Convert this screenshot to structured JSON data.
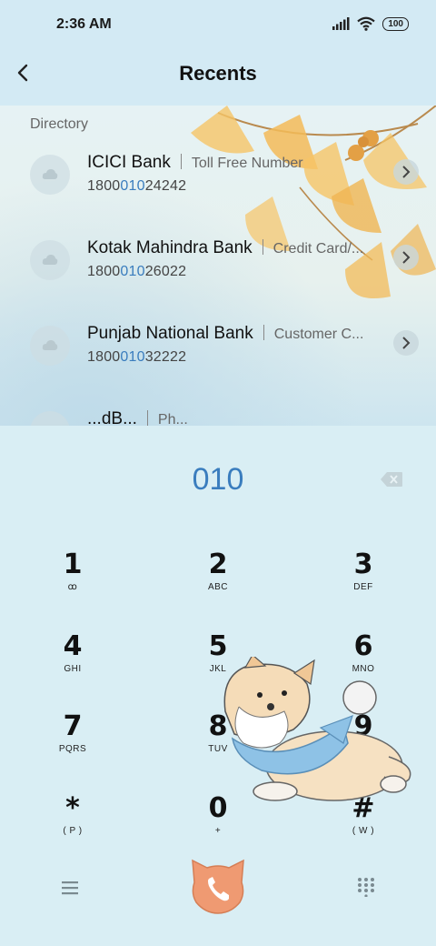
{
  "status": {
    "time": "2:36 AM",
    "battery": "100"
  },
  "header": {
    "title": "Recents"
  },
  "directory": {
    "label": "Directory",
    "items": [
      {
        "name": "ICICI Bank",
        "desc": "Toll Free Number",
        "num_pre": "1800",
        "num_hl": "010",
        "num_post": "24242"
      },
      {
        "name": "Kotak Mahindra Bank",
        "desc": "Credit Card/...",
        "num_pre": "1800",
        "num_hl": "010",
        "num_post": "26022"
      },
      {
        "name": "Punjab National Bank",
        "desc": "Customer C...",
        "num_pre": "1800",
        "num_hl": "010",
        "num_post": "32222"
      },
      {
        "name": "...dB...",
        "desc": "Ph...",
        "num_pre": "",
        "num_hl": "",
        "num_post": ""
      }
    ]
  },
  "dialer": {
    "number": "010",
    "keys": [
      {
        "digit": "1",
        "letters": "ꝏ"
      },
      {
        "digit": "2",
        "letters": "ABC"
      },
      {
        "digit": "3",
        "letters": "DEF"
      },
      {
        "digit": "4",
        "letters": "GHI"
      },
      {
        "digit": "5",
        "letters": "JKL"
      },
      {
        "digit": "6",
        "letters": "MNO"
      },
      {
        "digit": "7",
        "letters": "PQRS"
      },
      {
        "digit": "8",
        "letters": "TUV"
      },
      {
        "digit": "9",
        "letters": "WXYZ"
      },
      {
        "digit": "*",
        "letters": "( P )"
      },
      {
        "digit": "0",
        "letters": "+"
      },
      {
        "digit": "#",
        "letters": "( W )"
      }
    ]
  },
  "colors": {
    "accent": "#3a7dbe",
    "call": "#ef9a72",
    "background": "#d9eef4"
  },
  "icons": {
    "back": "chevron-left-icon",
    "delete": "backspace-icon",
    "menu": "menu-icon",
    "call": "phone-icon",
    "keypad": "keypad-icon"
  }
}
